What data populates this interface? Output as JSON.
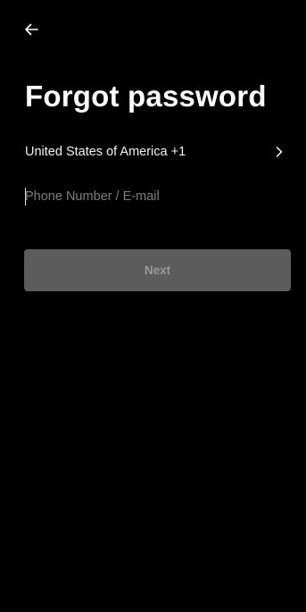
{
  "header": {
    "back_icon": "arrow-left-icon"
  },
  "page": {
    "title": "Forgot password"
  },
  "country": {
    "label": "United States of America +1",
    "chevron_icon": "chevron-right-icon"
  },
  "identity": {
    "placeholder": "Phone Number / E-mail",
    "value": ""
  },
  "actions": {
    "next_label": "Next"
  },
  "colors": {
    "background": "#000000",
    "text": "#ffffff",
    "placeholder": "#7e7e7e",
    "button_disabled_bg": "#5c5c5c",
    "button_disabled_text": "#9a9a9a"
  }
}
